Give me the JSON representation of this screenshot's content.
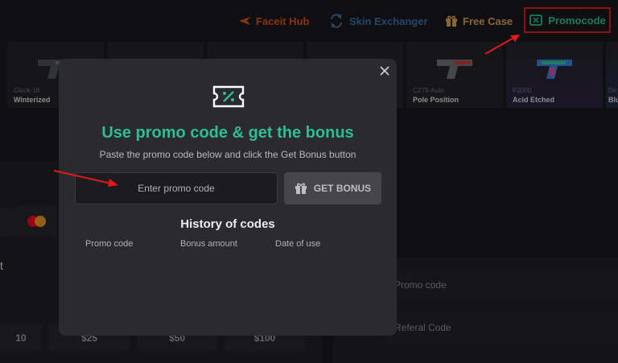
{
  "nav": {
    "items": [
      {
        "label": "Faceit Hub",
        "icon": "faceit-icon"
      },
      {
        "label": "Skin Exchanger",
        "icon": "exchange-icon"
      },
      {
        "label": "Free Case",
        "icon": "gift-icon"
      },
      {
        "label": "Promocode",
        "icon": "ticket-icon"
      }
    ]
  },
  "skins": [
    {
      "weapon": "Glock-18",
      "name": "Winterized"
    },
    {
      "weapon": "CZ75-Auto",
      "name": "Pole Position"
    },
    {
      "weapon": "P2000",
      "name": "Acid Etched"
    },
    {
      "weapon": "De",
      "name": "Blu"
    }
  ],
  "background": {
    "amounts": [
      "10",
      "$25",
      "$50",
      "$100"
    ],
    "side_letter": "t",
    "promo_field": "Promo code",
    "referral_field": "Referal Code"
  },
  "modal": {
    "title": "Use promo code & get the bonus",
    "subtitle": "Paste the promo code below and click the Get Bonus button",
    "input_placeholder": "Enter promo code",
    "button_label": "GET BONUS",
    "history_title": "History of codes",
    "columns": [
      "Promo code",
      "Bonus amount",
      "Date of use"
    ]
  },
  "colors": {
    "accent": "#2fbf8e",
    "highlight_box": "#e21a1a",
    "faceit": "#d1521f",
    "skin_exchanger": "#3b6aa3",
    "free_case": "#d59a5a"
  }
}
